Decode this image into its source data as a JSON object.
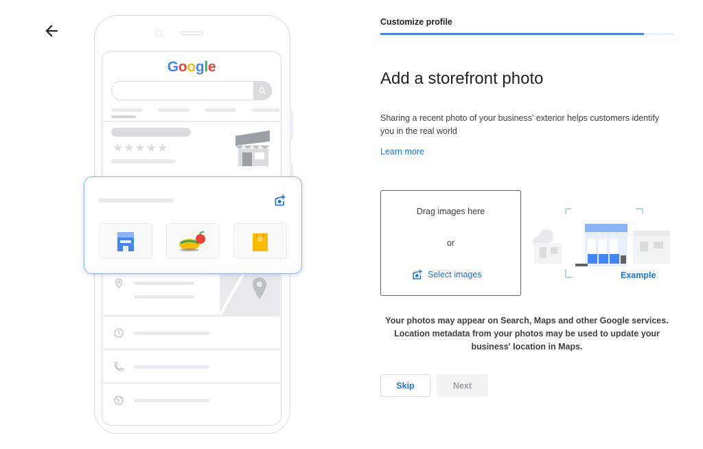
{
  "nav": {
    "back_icon": "arrow-left-icon"
  },
  "illustration": {
    "logo_letters": [
      {
        "ch": "G",
        "color": "#4285f4"
      },
      {
        "ch": "o",
        "color": "#ea4335"
      },
      {
        "ch": "o",
        "color": "#fbbc05"
      },
      {
        "ch": "g",
        "color": "#4285f4"
      },
      {
        "ch": "l",
        "color": "#34a853"
      },
      {
        "ch": "e",
        "color": "#ea4335"
      }
    ],
    "stars": "★★★★★",
    "icons": [
      "search-icon",
      "storefront-icon",
      "add-photo-icon",
      "location-pin-icon",
      "clock-icon",
      "phone-icon",
      "globe-icon"
    ]
  },
  "wizard": {
    "step_label": "Customize profile",
    "progress": 0.9,
    "title": "Add a storefront photo",
    "description": "Sharing a recent photo of your business' exterior helps customers identify you in the real world",
    "learn_more": "Learn more"
  },
  "upload": {
    "drag_text": "Drag images here",
    "or_text": "or",
    "select_label": "Select images",
    "example_label": "Example"
  },
  "notice": "Your photos may appear on Search, Maps and other Google services. Location metadata from your photos may be used to update your business' location in Maps.",
  "actions": {
    "skip": "Skip",
    "next": "Next"
  },
  "colors": {
    "accent": "#1a73e8",
    "progress": "#4285f4",
    "border": "#dadce0"
  }
}
